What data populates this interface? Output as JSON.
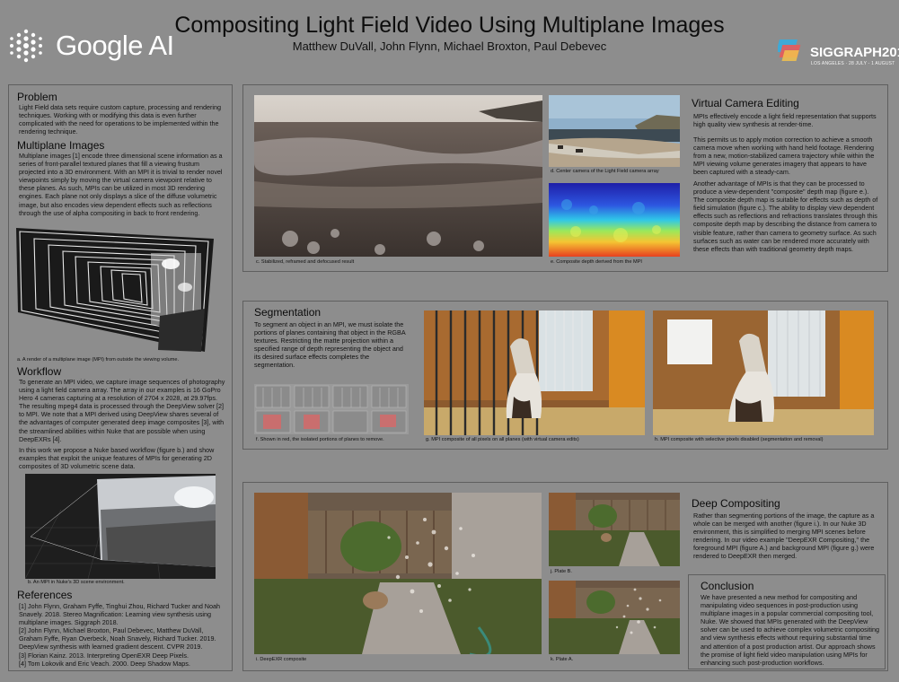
{
  "header": {
    "title": "Compositing Light Field Video Using Multiplane Images",
    "authors": "Matthew DuVall, John Flynn, Michael Broxton, Paul Debevec",
    "logo": "Google AI",
    "conference": "SIGGRAPH2019",
    "conference_dates": "LOS ANGELES · 28 JULY - 1 AUGUST"
  },
  "problem": {
    "heading": "Problem",
    "text": "Light Field data sets require custom capture, processing and rendering techniques. Working with or modifying this data is even further complicated with the need for operations to be implemented within the rendering technique."
  },
  "multiplane": {
    "heading": "Multiplane Images",
    "text": "Multiplane images [1] encode three dimensional scene information as a series of front-parallel textured planes that fill a viewing frustum projected into a 3D environment. With an MPI it is trivial to render novel viewpoints simply by moving the virtual camera viewpoint relative to these planes. As such, MPIs can be utilized in most 3D rendering engines. Each plane not only displays a slice of the diffuse volumetric image, but also encodes view dependent effects such as reflections through the use of alpha compositing in back to front rendering.",
    "caption_a": "a. A render of a multiplane image (MPI) from outside the viewing volume."
  },
  "workflow": {
    "heading": "Workflow",
    "text1": "To generate an MPI video, we capture image sequences of photography using a light field camera array. The array in our examples is 16 GoPro Hero 4 cameras capturing at a resolution of 2704 x 2028, at 29.97fps. The resulting mpeg4 data is processed through the DeepView solver [2] to MPI. We note that a MPI derived using DeepView shares several of the advantages of computer generated deep image composites [3], with the streamlined abilities within Nuke that are possible when using DeepEXRs [4].",
    "text2": "In this work we propose a Nuke based workflow (figure b.) and show examples that exploit the unique features of MPIs for generating 2D composites of 3D volumetric scene data.",
    "caption_b": "b. An MPI in Nuke's 3D scene environment."
  },
  "references": {
    "heading": "References",
    "items": [
      "[1] John Flynn, Graham Fyffe, Tinghui Zhou, Richard Tucker and Noah Snavely. 2018. Stereo Magnification: Learning view synthesis using multiplane images. Siggraph 2018.",
      "[2] John Flynn, Michael Broxton, Paul Debevec, Matthew DuVall, Graham Fyffe, Ryan Overbeck, Noah Snavely, Richard Tucker. 2019. DeepView synthesis with learned gradient descent. CVPR 2019.",
      "[3] Florian Kainz. 2013. Interpreting OpenEXR Deep Pixels.",
      "[4] Tom Lokovik and Eric Veach. 2000. Deep Shadow Maps."
    ]
  },
  "virtual_camera": {
    "heading": "Virtual Camera Editing",
    "p1": "MPIs effectively encode a light field representation that supports high quality view synthesis at render-time.",
    "p2": "This permits us to apply motion correction to achieve a smooth camera move when working with hand held footage. Rendering from a new, motion-stabilized camera trajectory while within the MPI viewing volume generates imagery that appears to have been captured with a steady-cam.",
    "p3": "Another advantage of MPIs is that they can be processed to produce a view-dependent \"composite\" depth map (figure e.). The composite depth map is suitable for effects such as depth of field simulation (figure c.). The ability to display view dependent effects such as reflections and refractions translates through this composite depth map by describing the distance from camera to visible feature, rather than camera to geometry surface. As such surfaces such as water can be rendered more accurately with these effects than with traditional geometry depth maps.",
    "caption_c": "c. Stabilized, reframed and defocused result",
    "caption_d": "d. Center camera of the Light Field camera array",
    "caption_e": "e. Composite depth derived from the MPI"
  },
  "segmentation": {
    "heading": "Segmentation",
    "text": "To segment an object in an MPI, we must isolate the portions of planes containing that object in the RGBA textures. Restricting the matte projection within a specified range of depth representing the object and its desired surface effects completes the segmentation.",
    "caption_f": "f. Shown in red, the isolated portions of planes to remove.",
    "caption_g": "g. MPI composite of all pixels on all planes (with virtual camera edits)",
    "caption_h": "h. MPI composite with selective pixels disabled (segmentation and removal)"
  },
  "deep_compositing": {
    "heading": "Deep Compositing",
    "text": "Rather than segmenting portions of the image, the capture as a whole can be merged with another (figure i.). In our Nuke 3D environment, this is simplified to merging MPI scenes before rendering. In our video example \"DeepEXR Compositing,\" the foreground MPI (figure A.) and background MPI (figure g.) were rendered to DeepEXR then merged.",
    "caption_i": "i. DeepEXR composite",
    "caption_j": "j. Plate B.",
    "caption_k": "k. Plate A."
  },
  "conclusion": {
    "heading": "Conclusion",
    "text": "We have presented a new method for compositing and manipulating video sequences in post-production using multiplane images in a popular commercial compositing tool, Nuke. We showed that MPIs generated with the DeepView solver can be used to achieve complex volumetric compositing and view synthesis effects without requiring substantial time and attention of a post production artist. Our approach shows the promise of light field video manipulation using MPIs for enhancing such post-production workflows."
  }
}
